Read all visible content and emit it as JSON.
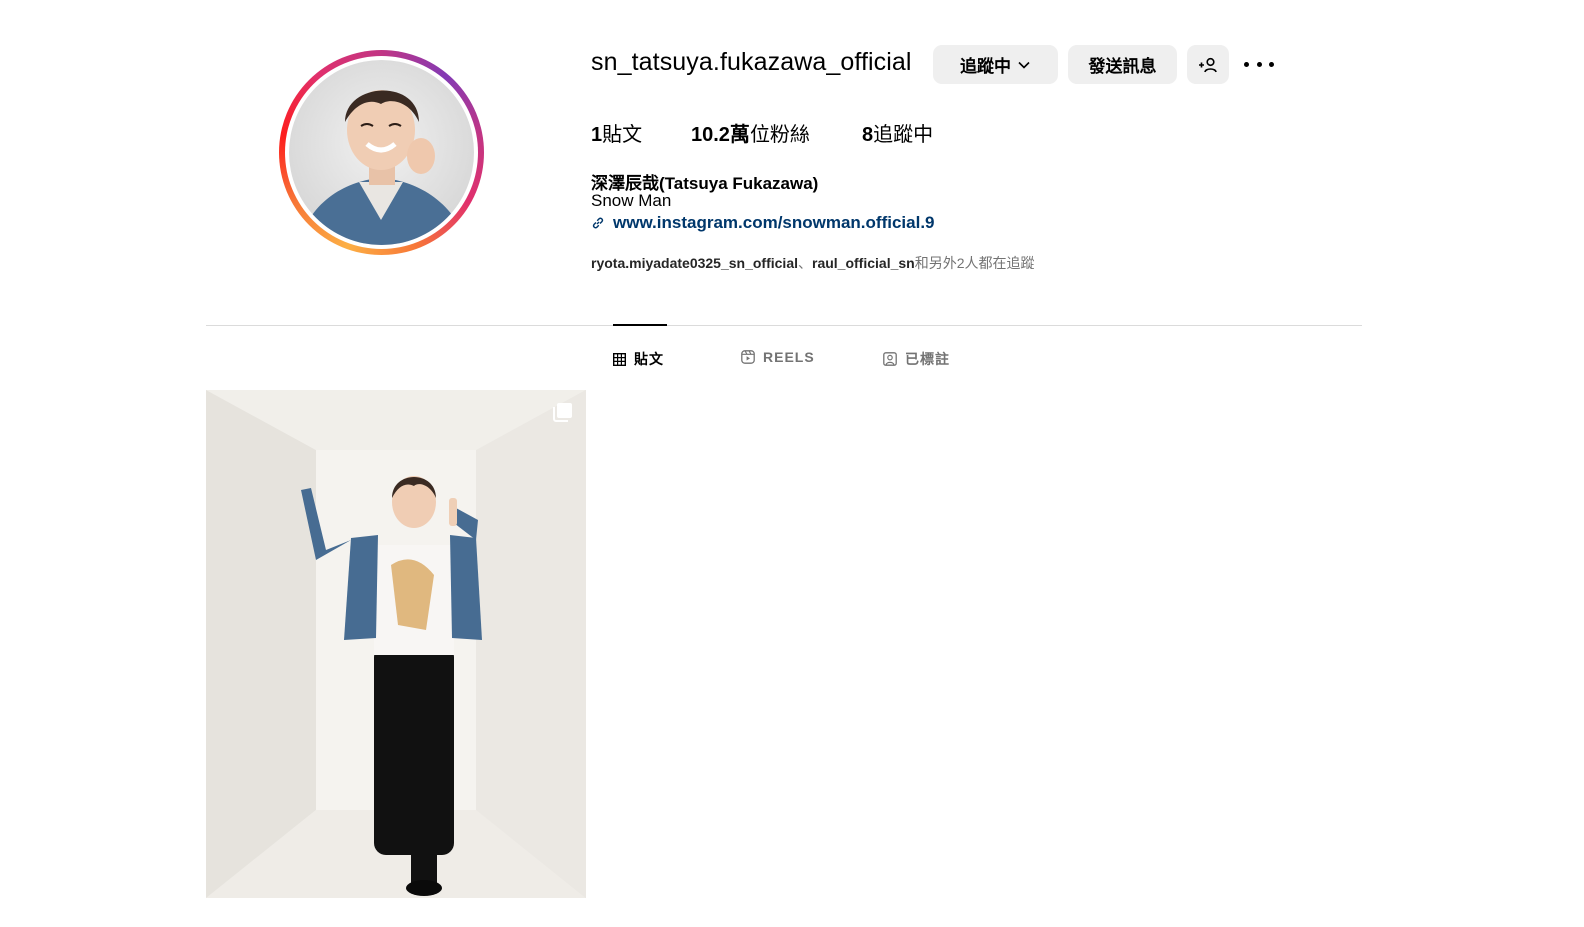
{
  "profile": {
    "username": "sn_tatsuya.fukazawa_official",
    "full_name": "深澤辰哉(Tatsuya Fukazawa)",
    "bio": "Snow Man",
    "link": "www.instagram.com/snowman.official.9"
  },
  "actions": {
    "following_label": "追蹤中",
    "message_label": "發送訊息"
  },
  "stats": {
    "posts_count": "1",
    "posts_label": "貼文",
    "followers_count": "10.2萬",
    "followers_label": "位粉絲",
    "following_count": "8",
    "following_label": "追蹤中"
  },
  "followed_by": {
    "user1": "ryota.miyadate0325_sn_official",
    "separator": "、",
    "user2": "raul_official_sn",
    "suffix": "和另外2人都在追蹤"
  },
  "tabs": [
    {
      "label": "貼文",
      "icon": "grid-icon",
      "active": true
    },
    {
      "label": "REELS",
      "icon": "reels-icon",
      "active": false
    },
    {
      "label": "已標註",
      "icon": "tagged-icon",
      "active": false
    }
  ],
  "posts": [
    {
      "type": "carousel",
      "icon": "multiple-photos-icon"
    }
  ],
  "colors": {
    "button_bg": "#efefef",
    "link": "#00376b",
    "muted": "#737373",
    "divider": "#dbdbdb"
  }
}
